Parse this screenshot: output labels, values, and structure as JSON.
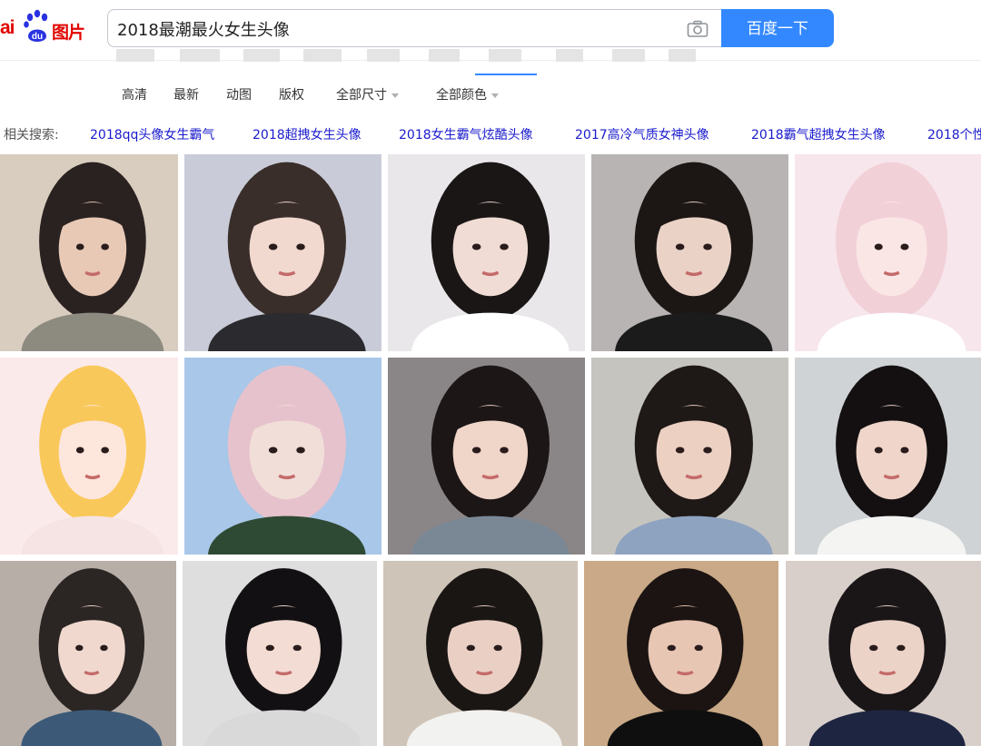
{
  "logo": {
    "prefix": "ai",
    "suffix": "图片"
  },
  "search": {
    "query": "2018最潮最火女生头像",
    "button_label": "百度一下"
  },
  "filters": [
    {
      "label": "高清"
    },
    {
      "label": "最新"
    },
    {
      "label": "动图"
    },
    {
      "label": "版权"
    },
    {
      "label": "全部尺寸",
      "dropdown": true
    },
    {
      "label": "全部颜色",
      "dropdown": true
    }
  ],
  "related": {
    "label": "相关搜索:",
    "links": [
      "2018qq头像女生霸气",
      "2018超拽女生头像",
      "2018女生霸气炫酷头像",
      "2017高冷气质女神头像",
      "2018霸气超拽女生头像",
      "2018个性"
    ]
  },
  "colors": {
    "accent": "#3388ff",
    "brand_red": "#e10601",
    "link": "#1a1acd"
  },
  "images": [
    {
      "name": "photo-girl-mirror-selfie",
      "bg": "#d9cdbf",
      "hair": "#2a2220",
      "skin": "#e8c9b6",
      "top": "#8d8a80"
    },
    {
      "name": "photo-girl-profile-ponytail",
      "bg": "#c9ccd8",
      "hair": "#3a2e2a",
      "skin": "#f1d9d0",
      "top": "#2b2a2e"
    },
    {
      "name": "photo-girl-lying-in-bed",
      "bg": "#e9e7ea",
      "hair": "#1a1616",
      "skin": "#f0dcd4",
      "top": "#ffffff"
    },
    {
      "name": "photo-girl-glasses",
      "bg": "#b7b4b3",
      "hair": "#1c1715",
      "skin": "#ead3c6",
      "top": "#1b1b1b"
    },
    {
      "name": "photo-girl-pink-hair",
      "bg": "#f7e6ec",
      "hair": "#f2d0d8",
      "skin": "#fbe6e6",
      "top": "#ffffff"
    },
    {
      "name": "anime-girl-blonde",
      "bg": "#fbeaea",
      "hair": "#f9c85a",
      "skin": "#fde6dc",
      "top": "#f6e4e4"
    },
    {
      "name": "photo-girl-with-cat",
      "bg": "#a9c7e8",
      "hair": "#e6c2cc",
      "skin": "#f2ded8",
      "top": "#2f4a34"
    },
    {
      "name": "photo-girl-peace-sign",
      "bg": "#8a8688",
      "hair": "#1c1616",
      "skin": "#f0d5c9",
      "top": "#7a8896"
    },
    {
      "name": "photo-girl-smiling-blue-tee",
      "bg": "#c6c4bf",
      "hair": "#1e1816",
      "skin": "#ecd0c2",
      "top": "#8ea3c0"
    },
    {
      "name": "photo-girl-long-hair-white",
      "bg": "#cfd3d6",
      "hair": "#141012",
      "skin": "#f0d6ca",
      "top": "#f4f4f2"
    },
    {
      "name": "photo-girl-short-hair",
      "bg": "#b8aea8",
      "hair": "#2b2523",
      "skin": "#f0d8cf",
      "top": "#3c5a78"
    },
    {
      "name": "photo-girl-black-hair-smile",
      "bg": "#dedede",
      "hair": "#121012",
      "skin": "#f3dcd3",
      "top": "#d9d9d9"
    },
    {
      "name": "photo-girl-white-shirt",
      "bg": "#cfc4b8",
      "hair": "#1a1614",
      "skin": "#ead0c4",
      "top": "#f2f2f0"
    },
    {
      "name": "photo-girl-phone-selfie",
      "bg": "#c9a987",
      "hair": "#1c1412",
      "skin": "#e7c6b3",
      "top": "#0f0f10"
    },
    {
      "name": "photo-girl-sailor-uniform",
      "bg": "#d8cfca",
      "hair": "#1a1618",
      "skin": "#ecd3c8",
      "top": "#1d2540"
    }
  ]
}
